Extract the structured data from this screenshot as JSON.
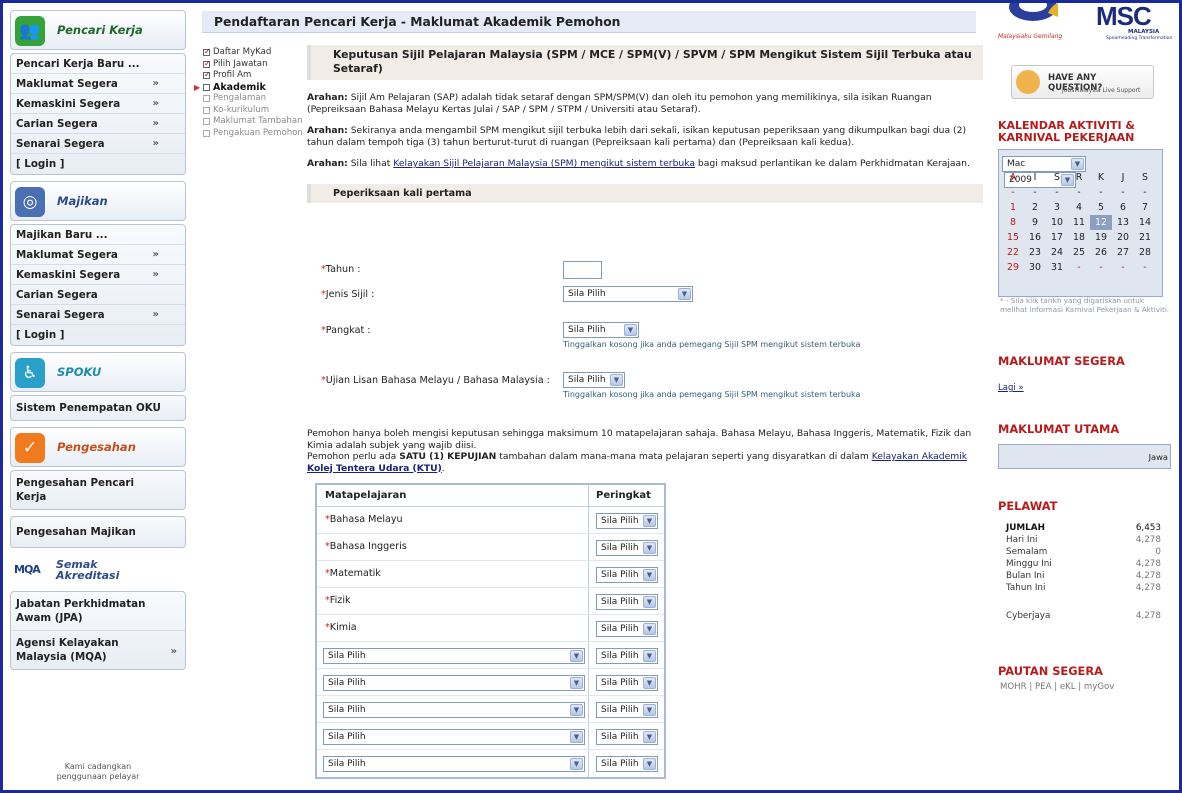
{
  "page_title": "Pendaftaran Pencari Kerja - Maklumat Akademik Pemohon",
  "nav": {
    "pencari": {
      "title": "Pencari Kerja",
      "items": [
        {
          "label": "Pencari Kerja Baru ...",
          "arrow": ""
        },
        {
          "label": "Maklumat Segera",
          "arrow": "»"
        },
        {
          "label": "Kemaskini Segera",
          "arrow": "»"
        },
        {
          "label": "Carian Segera",
          "arrow": "»"
        },
        {
          "label": "Senarai Segera",
          "arrow": "»"
        },
        {
          "label": "[ Login ]",
          "arrow": ""
        }
      ]
    },
    "majikan": {
      "title": "Majikan",
      "items": [
        {
          "label": "Majikan Baru ...",
          "arrow": ""
        },
        {
          "label": "Maklumat Segera",
          "arrow": "»"
        },
        {
          "label": "Kemaskini Segera",
          "arrow": "»"
        },
        {
          "label": "Carian Segera",
          "arrow": ""
        },
        {
          "label": "Senarai Segera",
          "arrow": "»"
        },
        {
          "label": "[ Login ]",
          "arrow": ""
        }
      ]
    },
    "spoku": {
      "title": "SPOKU",
      "item": "Sistem Penempatan OKU"
    },
    "pengesahan": {
      "title": "Pengesahan",
      "item1": "Pengesahan Pencari Kerja",
      "item2": "Pengesahan Majikan"
    },
    "mqa": {
      "logo": "MQA",
      "title_line1": "Semak",
      "title_line2": "Akreditasi",
      "item1": "Jabatan Perkhidmatan Awam (JPA)",
      "item2": "Agensi Kelayakan Malaysia (MQA)",
      "arrow": "»"
    },
    "bottom_note_line1": "Kami cadangkan",
    "bottom_note_line2": "penggunaan pelayar"
  },
  "steps": [
    {
      "label": "Daftar MyKad",
      "state": "done"
    },
    {
      "label": "Pilih Jawatan",
      "state": "done"
    },
    {
      "label": "Profil Am",
      "state": "done"
    },
    {
      "label": "Akademik",
      "state": "current"
    },
    {
      "label": "Pengalaman",
      "state": "pending"
    },
    {
      "label": "Ko-kurikulum",
      "state": "pending"
    },
    {
      "label": "Maklumat Tambahan",
      "state": "pending"
    },
    {
      "label": "Pengakuan Pemohon",
      "state": "pending"
    }
  ],
  "main": {
    "section_title": "Keputusan Sijil Pelajaran Malaysia (SPM / MCE / SPM(V) / SPVM / SPM Mengikut Sistem Sijil Terbuka atau Setaraf)",
    "arahan_label": "Arahan:",
    "para1": "Sijil Am Pelajaran (SAP) adalah tidak setaraf dengan SPM/SPM(V) dan oleh itu pemohon yang memilikinya, sila isikan Ruangan (Pepreiksaan Bahasa Melayu Kertas Julai / SAP / SPM / STPM / Universiti atau Setaraf).",
    "para2": "Sekiranya anda mengambil SPM mengikut sijil terbuka lebih dari sekali, isikan keputusan peperiksaan yang dikumpulkan bagi dua (2) tahun dalam tempoh tiga (3) tahun berturut-turut di ruangan (Pepreiksaan kali pertama) dan (Pepreiksaan kali kedua).",
    "para3_pre": "Sila lihat ",
    "para3_link": "Kelayakan Sijil Pelajaran Malaysia (SPM) mengikut sistem terbuka",
    "para3_post": " bagi maksud perlantikan ke dalam Perkhidmatan Kerajaan.",
    "subsection": "Peperiksaan kali pertama",
    "req_mark": "*",
    "tahun_label": "Tahun :",
    "tahun_value": "",
    "jenis_label": "Jenis Sijil :",
    "jenis_value": "Sila Pilih",
    "pangkat_label": "Pangkat :",
    "pangkat_value": "Sila Pilih",
    "pangkat_hint": "Tinggalkan kosong jika anda pemegang Sijil SPM mengikut sistem terbuka",
    "ujian_label": "Ujian Lisan Bahasa Melayu / Bahasa Malaysia :",
    "ujian_value": "Sila Pilih",
    "ujian_hint": "Tinggalkan kosong jika anda pemegang Sijil SPM mengikut sistem terbuka",
    "para4_line1": "Pemohon hanya boleh mengisi keputusan sehingga maksimum 10 matapelajaran sahaja. Bahasa Melayu, Bahasa Inggeris, Matematik, Fizik dan Kimia adalah subjek yang wajib diisi.",
    "para4_pre": "Pemohon perlu ada ",
    "para4_bold": "SATU (1) KEPUJIAN",
    "para4_mid": " tambahan dalam mana-mana mata pelajaran seperti yang disyaratkan di dalam ",
    "para4_link1": "Kelayakan Akademik",
    "para4_link2": "Kolej Tentera Udara (KTU)",
    "para4_end": "."
  },
  "subject_table": {
    "col1": "Matapelajaran",
    "col2": "Peringkat",
    "fixed_subjects": [
      "Bahasa Melayu",
      "Bahasa Inggeris",
      "Matematik",
      "Fizik",
      "Kimia"
    ],
    "select_value": "Sila Pilih"
  },
  "right": {
    "msc_logo": "MSC",
    "msc_sub": "MALAYSIA",
    "msc_tag": "Spearheading Transformation",
    "malaysia_tag": "Malaysiaku Gemilang",
    "haq_title": "HAVE ANY QUESTION?",
    "haq_sub": "JobsMalaysia Live Support",
    "kalendar_line1": "KALENDAR AKTIVITI &",
    "kalendar_line2": "KARNIVAL PEKERJAAN",
    "cal_month": "Mac",
    "cal_year": "2009",
    "cal_days": [
      "A",
      "I",
      "S",
      "R",
      "K",
      "J",
      "S"
    ],
    "cal_weeks": [
      [
        "-",
        "-",
        "-",
        "-",
        "-",
        "-",
        "-"
      ],
      [
        "1",
        "2",
        "3",
        "4",
        "5",
        "6",
        "7"
      ],
      [
        "8",
        "9",
        "10",
        "11",
        "12",
        "13",
        "14"
      ],
      [
        "15",
        "16",
        "17",
        "18",
        "19",
        "20",
        "21"
      ],
      [
        "22",
        "23",
        "24",
        "25",
        "26",
        "27",
        "28"
      ],
      [
        "29",
        "30",
        "31",
        "-",
        "-",
        "-",
        "-"
      ]
    ],
    "cal_today": "12",
    "cal_note": "* - Sila klik tarikh yang digariskan untuk melihat informasi Karnival Pekerjaan & Aktiviti.",
    "maklumat_segera": "MAKLUMAT SEGERA",
    "lagi": "Lagi »",
    "maklumat_utama": "MAKLUMAT UTAMA",
    "utama_text": "Jawa",
    "pelawat": "PELAWAT",
    "stats": [
      {
        "k": "JUMLAH",
        "v": "6,453",
        "bold": true
      },
      {
        "k": "Hari Ini",
        "v": "4,278"
      },
      {
        "k": "Semalam",
        "v": "0"
      },
      {
        "k": "Minggu Ini",
        "v": "4,278"
      },
      {
        "k": "Bulan Ini",
        "v": "4,278"
      },
      {
        "k": "Tahun Ini",
        "v": "4,278"
      },
      {
        "k": "",
        "v": ""
      },
      {
        "k": "Cyberjaya",
        "v": "4,278"
      }
    ],
    "pautan": "PAUTAN SEGERA",
    "pautan_links": "MOHR | PEA | eKL | myGov"
  },
  "colors": {
    "brand_red": "#b71c1c",
    "frame_blue": "#1a2a9a",
    "link": "#1a237e"
  }
}
